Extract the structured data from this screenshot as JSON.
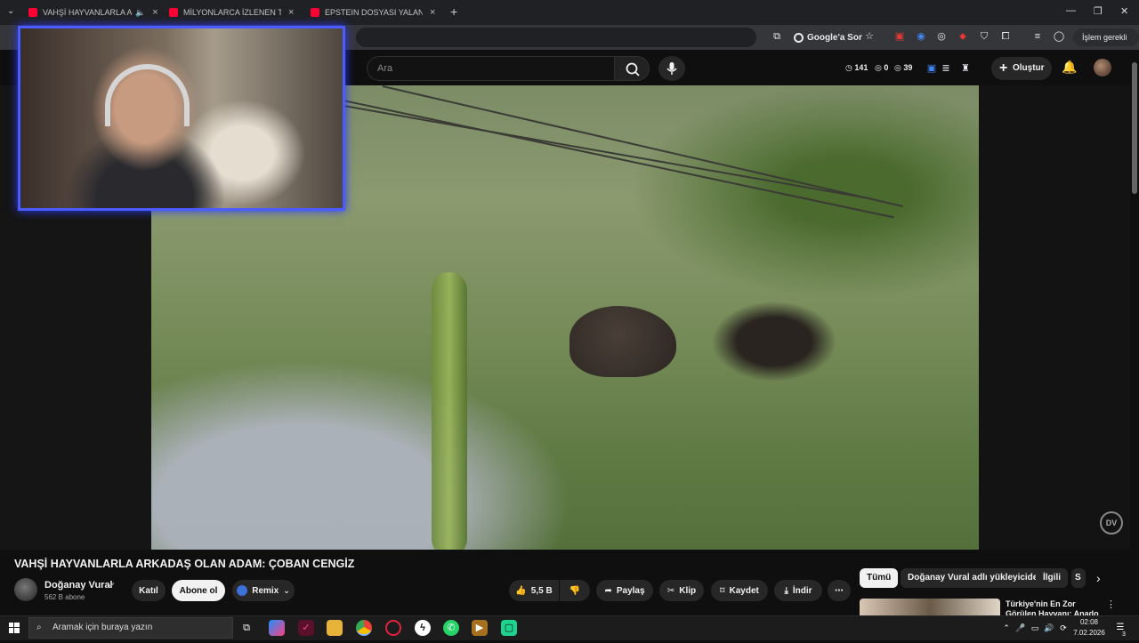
{
  "browser": {
    "tabs": [
      {
        "label": "VAHŞİ HAYVANLARLA ARKA",
        "audio": true
      },
      {
        "label": "MİLYONLARCA İZLENEN TREN"
      },
      {
        "label": "EPSTEIN DOSYASI YALAN SÖYL"
      }
    ],
    "google_sor": "Google'a Sor",
    "update_label": "İşlem gerekli"
  },
  "youtube": {
    "search_placeholder": "Ara",
    "stats": {
      "a": "141",
      "b": "0",
      "c": "39"
    },
    "create_label": "Oluştur",
    "video": {
      "title": "VAHŞİ HAYVANLARLA ARKADAŞ OLAN ADAM: ÇOBAN CENGİZ",
      "channel": "Doğanay Vural",
      "subscribers": "562 B abone",
      "join_label": "Katıl",
      "subscribe_label": "Abone ol",
      "remix_label": "Remix",
      "likes": "5,5 B",
      "share_label": "Paylaş",
      "clip_label": "Klip",
      "save_label": "Kaydet",
      "download_label": "İndir",
      "watermark": "DV"
    },
    "chips": [
      "Tümü",
      "Doğanay Vural adlı yükleyiciden",
      "İlgili",
      "S"
    ],
    "recommendation": {
      "title": "Türkiye'nin En Zor Görülen Hayvanı: Anado"
    }
  },
  "taskbar": {
    "search_placeholder": "Aramak için buraya yazın",
    "time": "02:08",
    "date": "7.02.2026",
    "notification_count": "3"
  },
  "colors": {
    "accent": "#ff0033",
    "webcam_border": "#4a5bff",
    "background": "#0f0f0f"
  }
}
